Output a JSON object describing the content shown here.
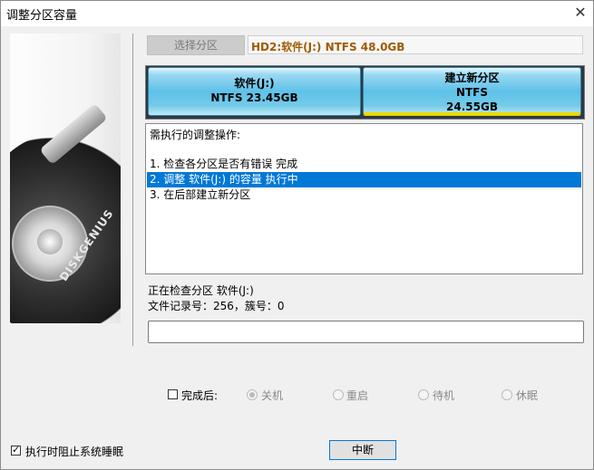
{
  "window": {
    "title": "调整分区容量",
    "close_glyph": "✕"
  },
  "banner": {
    "brand": "DISKGENIUS"
  },
  "top": {
    "select_button": "选择分区",
    "disk_info": "HD2:软件(J:) NTFS 48.0GB"
  },
  "partitions": [
    {
      "line1": "软件(J:)",
      "line2": "NTFS 23.45GB"
    },
    {
      "line1": "建立新分区",
      "line2": "NTFS",
      "line3": "24.55GB"
    }
  ],
  "operations": {
    "header": "需执行的调整操作:",
    "items": [
      "1. 检查各分区是否有错误     完成",
      "2. 调整 软件(J:) 的容量     执行中",
      "3. 在后部建立新分区"
    ],
    "selected_index": 1
  },
  "status": {
    "line1": "正在检查分区 软件(J:)",
    "line2": "文件记录号：256，簇号：0"
  },
  "progress_percent": 0,
  "after_done": {
    "checkbox_label": "完成后:",
    "checked": false,
    "options": [
      "关机",
      "重启",
      "待机",
      "休眠"
    ],
    "selected": "关机"
  },
  "prevent_sleep": {
    "label": "执行时阻止系统睡眠",
    "checked": true
  },
  "stop_button": "中断",
  "colors": {
    "selection": "#0078d7",
    "disk_info_text": "#a05a00",
    "partition_fill": "#5ec1e8"
  }
}
